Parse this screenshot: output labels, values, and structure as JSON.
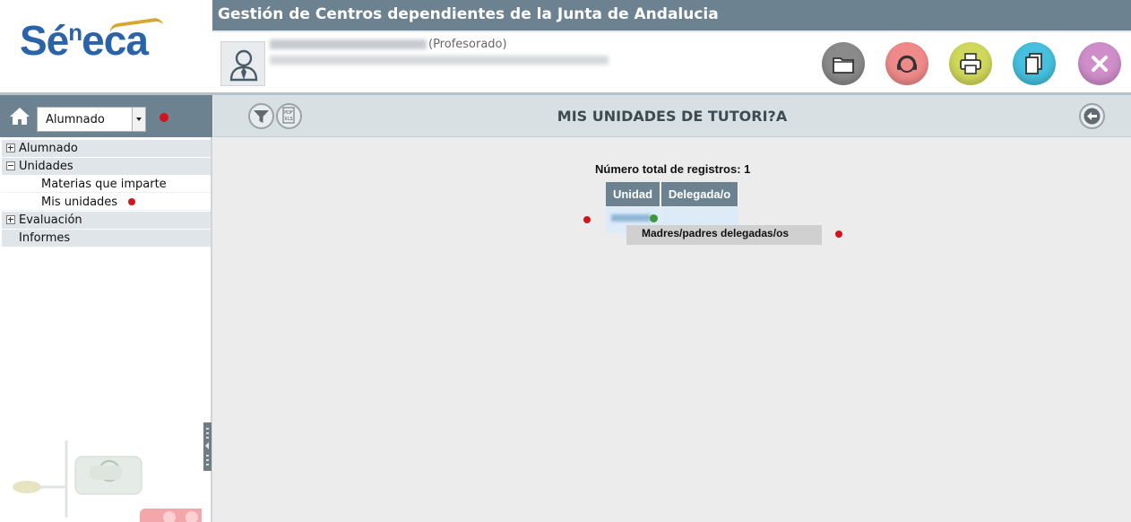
{
  "header": {
    "logo_main": "Sé",
    "logo_sup": "n",
    "logo_end": "eca",
    "app_title": "Gestión de Centros dependientes de la Junta de Andalucia",
    "user_role": "(Profesorado)",
    "toolbar_icons": [
      "folder-icon",
      "support-headset-icon",
      "print-icon",
      "copy-icon",
      "close-icon"
    ],
    "toolbar_colors": [
      "#8a8a8a",
      "#f08a8a",
      "#cfd85a",
      "#45c0de",
      "#cf8ec9"
    ]
  },
  "sidebar": {
    "profile_select": "Alumnado",
    "menu": [
      {
        "label": "Alumnado",
        "type": "group",
        "expanded": false
      },
      {
        "label": "Unidades",
        "type": "group",
        "expanded": true
      },
      {
        "label": "Materias que imparte",
        "type": "sub"
      },
      {
        "label": "Mis unidades",
        "type": "sub"
      },
      {
        "label": "Evaluación",
        "type": "group",
        "expanded": false
      },
      {
        "label": "Informes",
        "type": "group",
        "expanded": null
      }
    ]
  },
  "main": {
    "page_title": "MIS UNIDADES DE TUTORI?A",
    "record_count": "Número total de registros: 1",
    "table": {
      "columns": [
        "Unidad",
        "Delegada/o"
      ]
    },
    "tooltip": "Madres/padres delegadas/os"
  },
  "colors": {
    "header_bar": "#6d8290",
    "accent_dot": "#d5131d",
    "logo_blue": "#2a63a8",
    "logo_gold": "#d6a92e"
  }
}
